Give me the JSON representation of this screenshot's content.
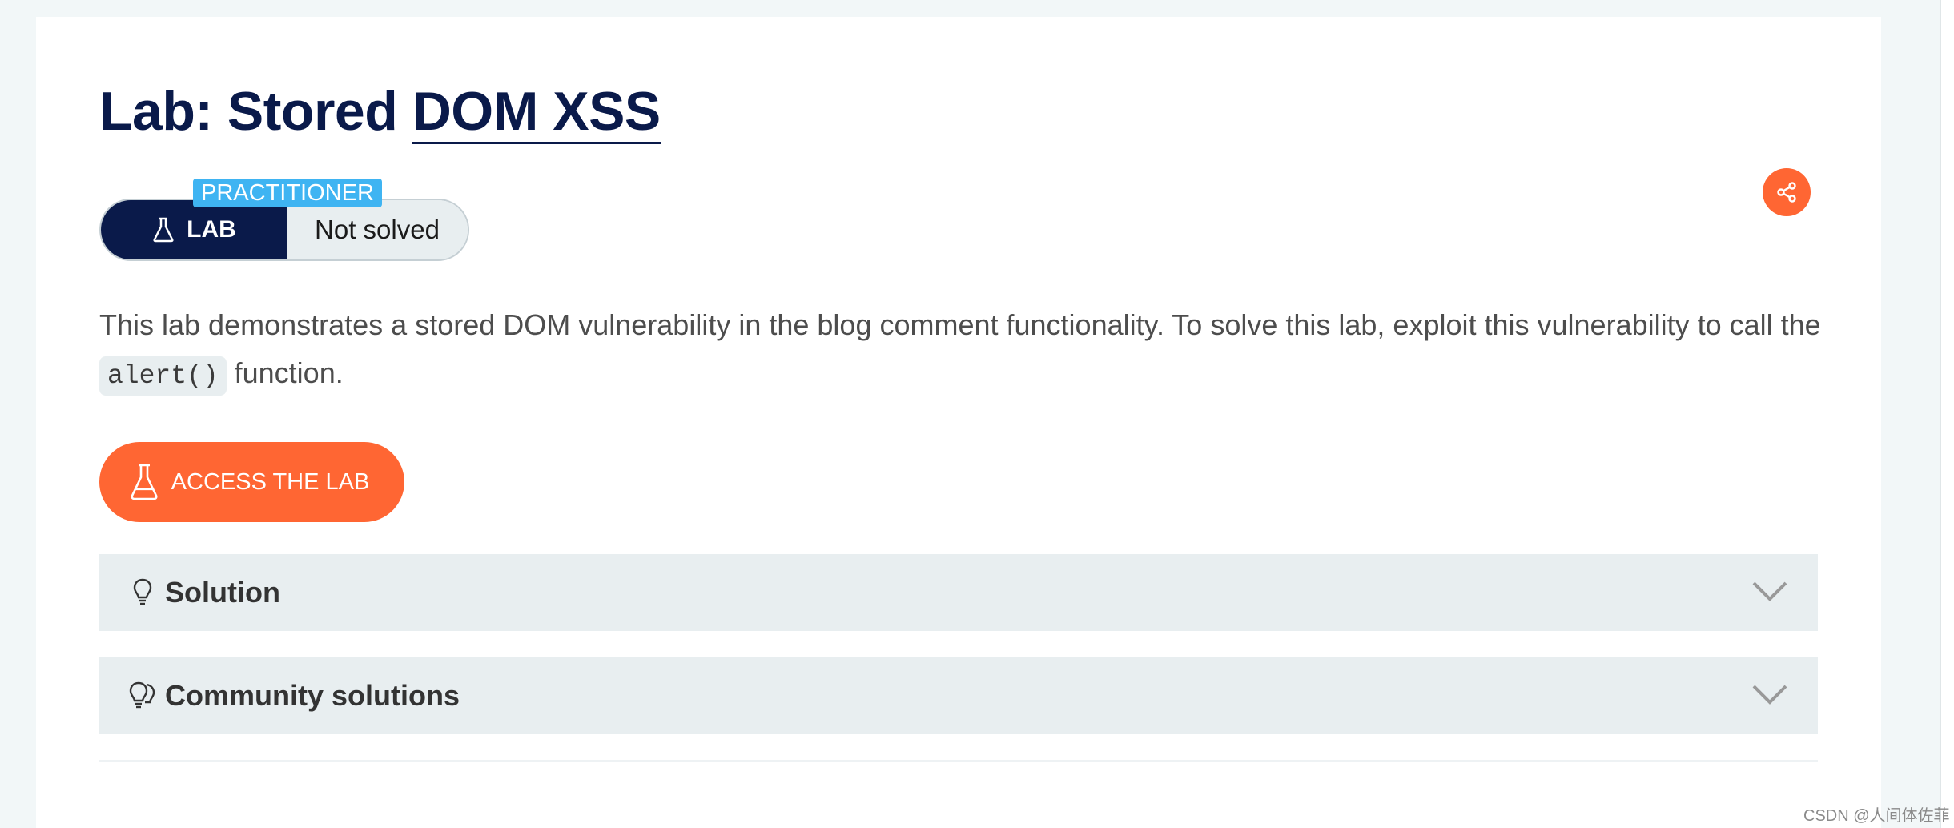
{
  "title": {
    "prefix": "Lab: Stored ",
    "link": "DOM XSS"
  },
  "lab_status": {
    "level": "PRACTITIONER",
    "type": "LAB",
    "status": "Not solved"
  },
  "description": {
    "before": "This lab demonstrates a stored DOM vulnerability in the blog comment functionality. To solve this lab, exploit this vulnerability to call the ",
    "code": "alert()",
    "after": " function."
  },
  "access_button": {
    "label": "ACCESS THE LAB",
    "icon": "flask-icon"
  },
  "accordions": [
    {
      "label": "Solution",
      "icon": "lightbulb-icon"
    },
    {
      "label": "Community solutions",
      "icon": "lightbulbs-icon"
    }
  ],
  "share": {
    "icon": "share-icon"
  },
  "watermark": "CSDN @人间体佐菲",
  "colors": {
    "navy": "#0a1a4a",
    "orange": "#ff6633",
    "badge_blue": "#3fb4f2",
    "panel_gray": "#e8eef0"
  }
}
